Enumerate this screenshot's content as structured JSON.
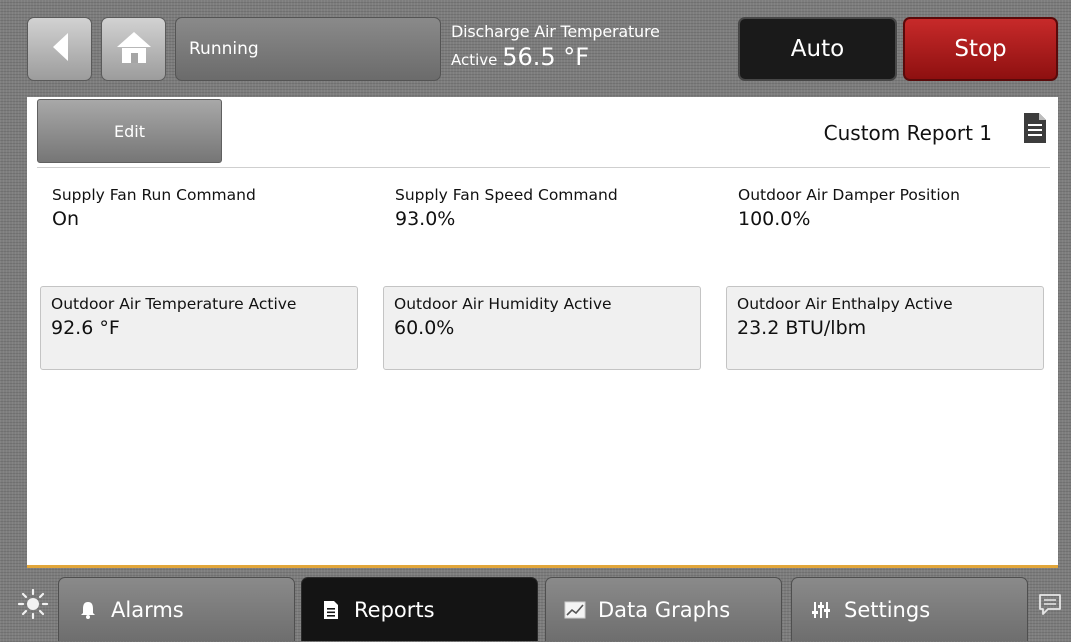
{
  "header": {
    "status": "Running",
    "discharge": {
      "title": "Discharge Air Temperature",
      "state": "Active",
      "value": "56.5 °F"
    },
    "auto_label": "Auto",
    "stop_label": "Stop"
  },
  "report": {
    "edit_label": "Edit",
    "title": "Custom Report 1",
    "items": [
      {
        "label": "Supply Fan Run Command",
        "value": "On"
      },
      {
        "label": "Supply Fan Speed Command",
        "value": "93.0%"
      },
      {
        "label": "Outdoor Air Damper Position",
        "value": "100.0%"
      },
      {
        "label": "Outdoor Air Temperature Active",
        "value": "92.6 °F"
      },
      {
        "label": "Outdoor Air Humidity Active",
        "value": "60.0%"
      },
      {
        "label": "Outdoor Air Enthalpy Active",
        "value": "23.2 BTU/lbm"
      }
    ]
  },
  "tabs": [
    {
      "label": "Alarms",
      "icon": "bell-icon"
    },
    {
      "label": "Reports",
      "icon": "document-icon",
      "active": true
    },
    {
      "label": "Data Graphs",
      "icon": "chart-icon"
    },
    {
      "label": "Settings",
      "icon": "sliders-icon"
    }
  ],
  "colors": {
    "stop": "#b01c1c",
    "auto": "#1a1a1a",
    "accent_line": "#e2a63a"
  }
}
